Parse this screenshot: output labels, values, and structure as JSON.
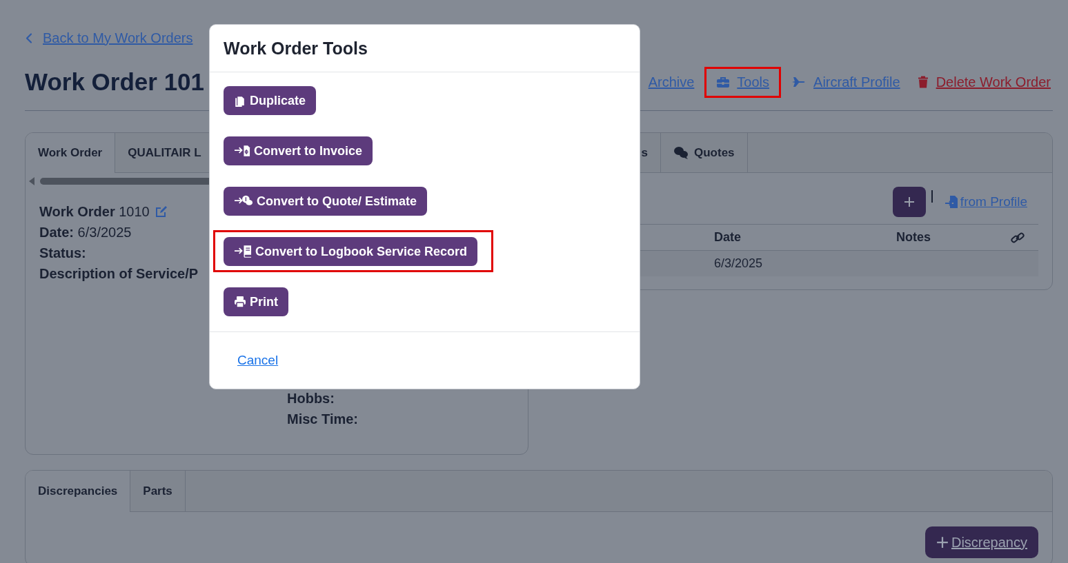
{
  "back_link": "Back to My Work Orders",
  "title": "Work Order 101",
  "header_actions": [
    {
      "kind": "archive",
      "label": "Archive",
      "highlighted": false
    },
    {
      "kind": "tools",
      "label": "Tools",
      "highlighted": true
    },
    {
      "kind": "aircraft",
      "label": "Aircraft Profile",
      "highlighted": false
    },
    {
      "kind": "delete",
      "label": "Delete Work Order",
      "highlighted": false
    }
  ],
  "detail_card": {
    "tabs": [
      {
        "label": "Work Order",
        "selected": true
      },
      {
        "label": "QUALITAIR L",
        "selected": false
      }
    ],
    "fields": [
      {
        "label": "Work Order",
        "value": "1010",
        "editable": true
      },
      {
        "label": "Date:",
        "value": "6/3/2025",
        "editable": false
      },
      {
        "label": "Status:",
        "editable": false
      },
      {
        "label": "Description of Service/P",
        "editable": false
      }
    ],
    "time_fields": [
      {
        "label": "Hobbs:"
      },
      {
        "label": "Misc Time:"
      }
    ]
  },
  "quotes_card": {
    "tabs": [
      {
        "kind": "plain",
        "label": "s",
        "selected": false
      },
      {
        "kind": "quotes",
        "label": "Quotes",
        "selected": false
      }
    ],
    "import_link": "from Profile",
    "table": {
      "columns": [
        "Date",
        "Notes"
      ],
      "rows": [
        {
          "date": "6/3/2025"
        }
      ]
    }
  },
  "bottom_card": {
    "tabs": [
      {
        "label": "Discrepancies",
        "selected": true
      },
      {
        "label": "Parts",
        "selected": false
      }
    ],
    "add_button": "Discrepancy"
  },
  "modal": {
    "title": "Work Order Tools",
    "actions": [
      {
        "kind": "duplicate",
        "label": "Duplicate",
        "highlighted": false
      },
      {
        "kind": "invoice",
        "label": "Convert to Invoice",
        "highlighted": false
      },
      {
        "kind": "quote",
        "label": "Convert to Quote/ Estimate",
        "highlighted": false
      },
      {
        "kind": "logbook",
        "label": "Convert to Logbook Service Record",
        "highlighted": true
      },
      {
        "kind": "print",
        "label": "Print",
        "highlighted": false
      }
    ],
    "cancel": "Cancel"
  }
}
